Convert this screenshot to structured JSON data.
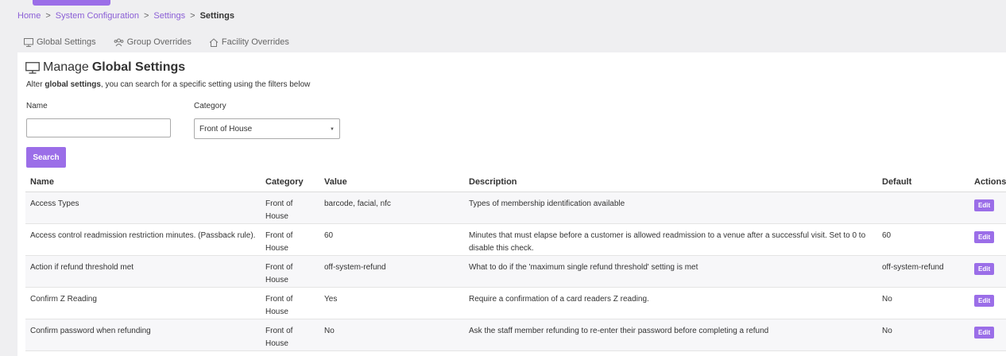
{
  "breadcrumb": {
    "home": "Home",
    "system_config": "System Configuration",
    "settings_link": "Settings",
    "current": "Settings",
    "separator": ">"
  },
  "tabs": [
    {
      "label": "Global Settings",
      "icon": "monitor-icon"
    },
    {
      "label": "Group Overrides",
      "icon": "users-icon"
    },
    {
      "label": "Facility Overrides",
      "icon": "home-icon"
    }
  ],
  "page": {
    "title_prefix": "Manage",
    "title_bold": "Global Settings",
    "subtitle_prefix": "Alter ",
    "subtitle_bold": "global settings",
    "subtitle_suffix": ", you can search for a specific setting using the filters below"
  },
  "filters": {
    "name_label": "Name",
    "name_value": "",
    "category_label": "Category",
    "category_value": "Front of House",
    "search_label": "Search"
  },
  "table": {
    "headers": [
      "Name",
      "Category",
      "Value",
      "Description",
      "Default",
      "Actions"
    ],
    "rows": [
      {
        "name": "Access Types",
        "category": "Front of House",
        "value": "barcode, facial, nfc",
        "description": "Types of membership identification available",
        "default": "",
        "action": "Edit"
      },
      {
        "name": "Access control readmission restriction minutes. (Passback rule).",
        "category": "Front of House",
        "value": "60",
        "description": "Minutes that must elapse before a customer is allowed readmission to a venue after a successful visit. Set to 0 to disable this check.",
        "default": "60",
        "action": "Edit"
      },
      {
        "name": "Action if refund threshold met",
        "category": "Front of House",
        "value": "off-system-refund",
        "description": "What to do if the 'maximum single refund threshold' setting is met",
        "default": "off-system-refund",
        "action": "Edit"
      },
      {
        "name": "Confirm Z Reading",
        "category": "Front of House",
        "value": "Yes",
        "description": "Require a confirmation of a card readers Z reading.",
        "default": "No",
        "action": "Edit"
      },
      {
        "name": "Confirm password when refunding",
        "category": "Front of House",
        "value": "No",
        "description": "Ask the staff member refunding to re-enter their password before completing a refund",
        "default": "No",
        "action": "Edit"
      }
    ]
  },
  "colors": {
    "accent": "#9b6ee8",
    "link": "#8b5fd6",
    "background": "#efeff1"
  }
}
